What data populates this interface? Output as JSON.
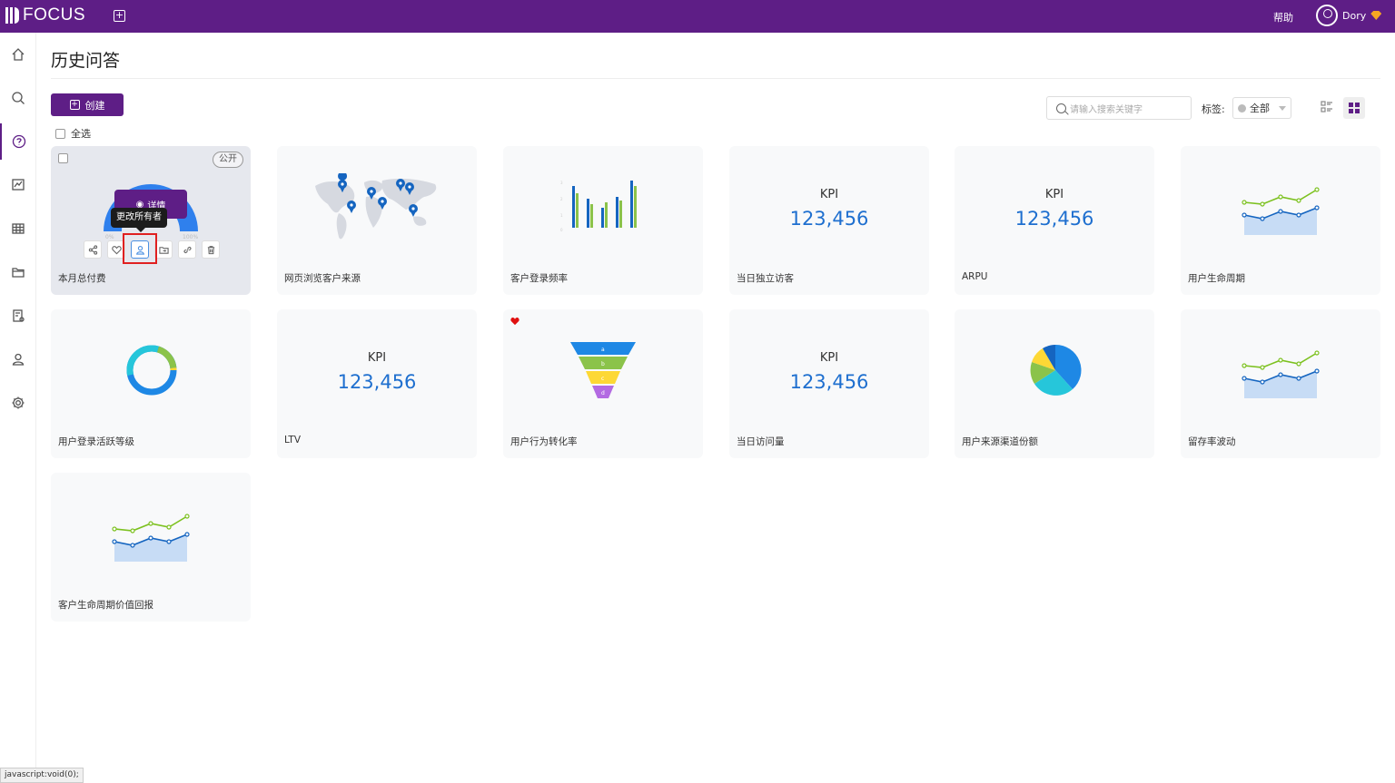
{
  "topbar": {
    "brand": "FOCUS",
    "add_tab": "+",
    "help": "帮助",
    "username": "Dory"
  },
  "sidebar": {
    "items": [
      {
        "icon": "home-icon"
      },
      {
        "icon": "search-icon"
      },
      {
        "icon": "question-icon",
        "active": true
      },
      {
        "icon": "chart-icon"
      },
      {
        "icon": "table-icon"
      },
      {
        "icon": "folder-icon"
      },
      {
        "icon": "task-settings-icon"
      },
      {
        "icon": "user-icon"
      },
      {
        "icon": "gear-icon"
      }
    ]
  },
  "page": {
    "title": "历史问答",
    "create": "创建",
    "select_all": "全选",
    "search_placeholder": "请输入搜索关键字",
    "tag_label": "标签:",
    "tag_value": "全部"
  },
  "cards": [
    {
      "title": "本月总付费",
      "kind": "gauge",
      "badge": "公开",
      "detail": "详情",
      "tooltip": "更改所有者",
      "gauge_min": "0%",
      "gauge_max": "100%"
    },
    {
      "title": "网页浏览客户来源",
      "kind": "map"
    },
    {
      "title": "客户登录频率",
      "kind": "bar"
    },
    {
      "title": "当日独立访客",
      "kind": "kpi",
      "kpi_label": "KPI",
      "kpi_value": "123,456"
    },
    {
      "title": "ARPU",
      "kind": "kpi",
      "kpi_label": "KPI",
      "kpi_value": "123,456"
    },
    {
      "title": "用户生命周期",
      "kind": "line"
    },
    {
      "title": "用户登录活跃等级",
      "kind": "donut"
    },
    {
      "title": "LTV",
      "kind": "kpi",
      "kpi_label": "KPI",
      "kpi_value": "123,456"
    },
    {
      "title": "用户行为转化率",
      "kind": "funnel",
      "favorite": true,
      "funnel_labels": [
        "a",
        "b",
        "c",
        "d"
      ]
    },
    {
      "title": "当日访问量",
      "kind": "kpi",
      "kpi_label": "KPI",
      "kpi_value": "123,456"
    },
    {
      "title": "用户来源渠道份额",
      "kind": "pie"
    },
    {
      "title": "留存率波动",
      "kind": "line"
    },
    {
      "title": "客户生命周期价值回报",
      "kind": "line"
    }
  ],
  "statusbar": "javascript:void(0);",
  "colors": {
    "brand": "#5e1e86",
    "kpi": "#1e6fcf",
    "highlight": "#e02020"
  }
}
